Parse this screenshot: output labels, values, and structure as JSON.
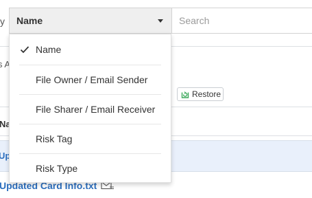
{
  "toolbar": {
    "search_by_selected": "Name",
    "search_placeholder": "Search"
  },
  "dropdown": {
    "items": [
      {
        "label": "Name",
        "selected": true
      },
      {
        "label": "File Owner / Email Sender",
        "selected": false
      },
      {
        "label": "File Sharer / Email Receiver",
        "selected": false
      },
      {
        "label": "Risk Tag",
        "selected": false
      },
      {
        "label": "Risk Type",
        "selected": false
      }
    ]
  },
  "background": {
    "left_clipped_text_1": "y",
    "left_clipped_text_2": "s A",
    "restore_label": "Restore",
    "column_header": "Na",
    "highlighted_row_text": "Up",
    "file_name": "Updated Card Info.txt"
  },
  "colors": {
    "link": "#2c6fbf",
    "highlight_row": "#e9f0fb",
    "select_bg": "#efefef",
    "restore_icon": "#3aa85a"
  }
}
